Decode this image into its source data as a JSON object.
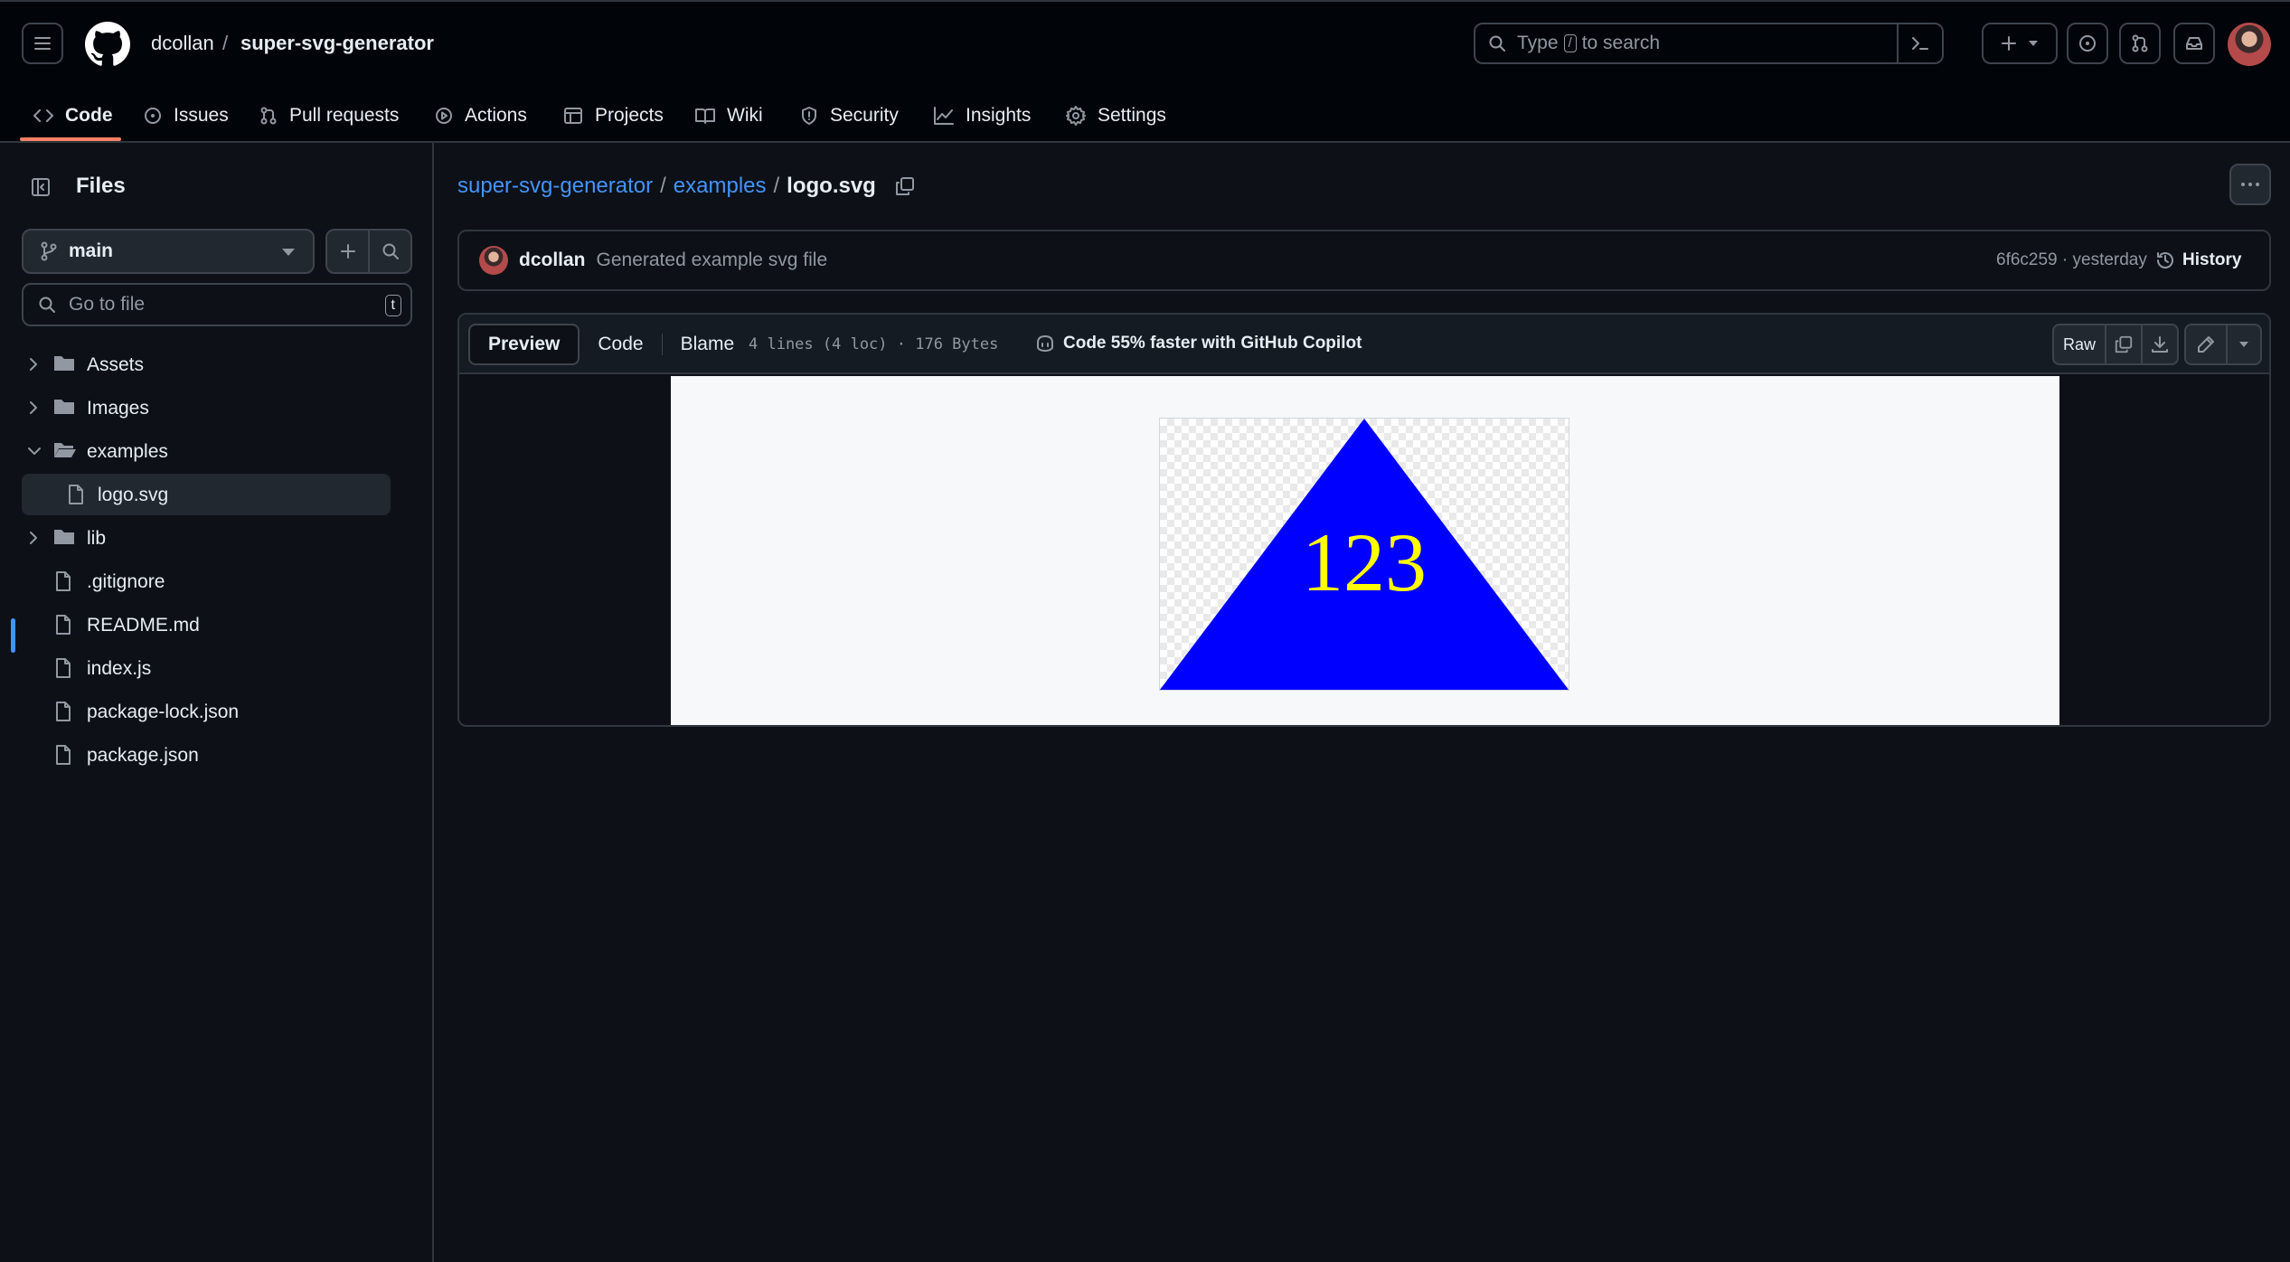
{
  "header": {
    "owner": "dcollan",
    "separator": "/",
    "repo": "super-svg-generator",
    "search_prefix": "Type",
    "search_key": "/",
    "search_suffix": "to search"
  },
  "repo_tabs": [
    {
      "label": "Code",
      "icon": "code-icon",
      "active": true
    },
    {
      "label": "Issues",
      "icon": "issue-icon"
    },
    {
      "label": "Pull requests",
      "icon": "pull-request-icon"
    },
    {
      "label": "Actions",
      "icon": "play-icon"
    },
    {
      "label": "Projects",
      "icon": "table-icon"
    },
    {
      "label": "Wiki",
      "icon": "book-icon"
    },
    {
      "label": "Security",
      "icon": "shield-icon"
    },
    {
      "label": "Insights",
      "icon": "graph-icon"
    },
    {
      "label": "Settings",
      "icon": "gear-icon"
    }
  ],
  "sidebar": {
    "title": "Files",
    "branch": "main",
    "goto_placeholder": "Go to file",
    "goto_key": "t",
    "tree": [
      {
        "label": "Assets",
        "type": "folder",
        "expanded": false
      },
      {
        "label": "Images",
        "type": "folder",
        "expanded": false
      },
      {
        "label": "examples",
        "type": "folder",
        "expanded": true
      },
      {
        "label": "logo.svg",
        "type": "file",
        "selected": true
      },
      {
        "label": "lib",
        "type": "folder",
        "expanded": false
      },
      {
        "label": ".gitignore",
        "type": "file"
      },
      {
        "label": "README.md",
        "type": "file"
      },
      {
        "label": "index.js",
        "type": "file"
      },
      {
        "label": "package-lock.json",
        "type": "file"
      },
      {
        "label": "package.json",
        "type": "file"
      }
    ]
  },
  "path": {
    "repo": "super-svg-generator",
    "folder": "examples",
    "file": "logo.svg",
    "sep": "/"
  },
  "commit": {
    "author": "dcollan",
    "message": "Generated example svg file",
    "hash_time": "6f6c259 · yesterday",
    "history_label": "History"
  },
  "file": {
    "view_tabs": [
      "Preview",
      "Code",
      "Blame"
    ],
    "active_view": "Preview",
    "meta": "4 lines (4 loc) · 176 Bytes",
    "copilot": "Code 55% faster with GitHub Copilot",
    "raw_label": "Raw"
  },
  "svg_preview": {
    "text": "123",
    "fill": "#0000ff",
    "text_color": "#ffff00"
  },
  "colors": {
    "accent_link": "#4493f8",
    "tab_underline": "#f78166",
    "background": "#0d1117"
  }
}
